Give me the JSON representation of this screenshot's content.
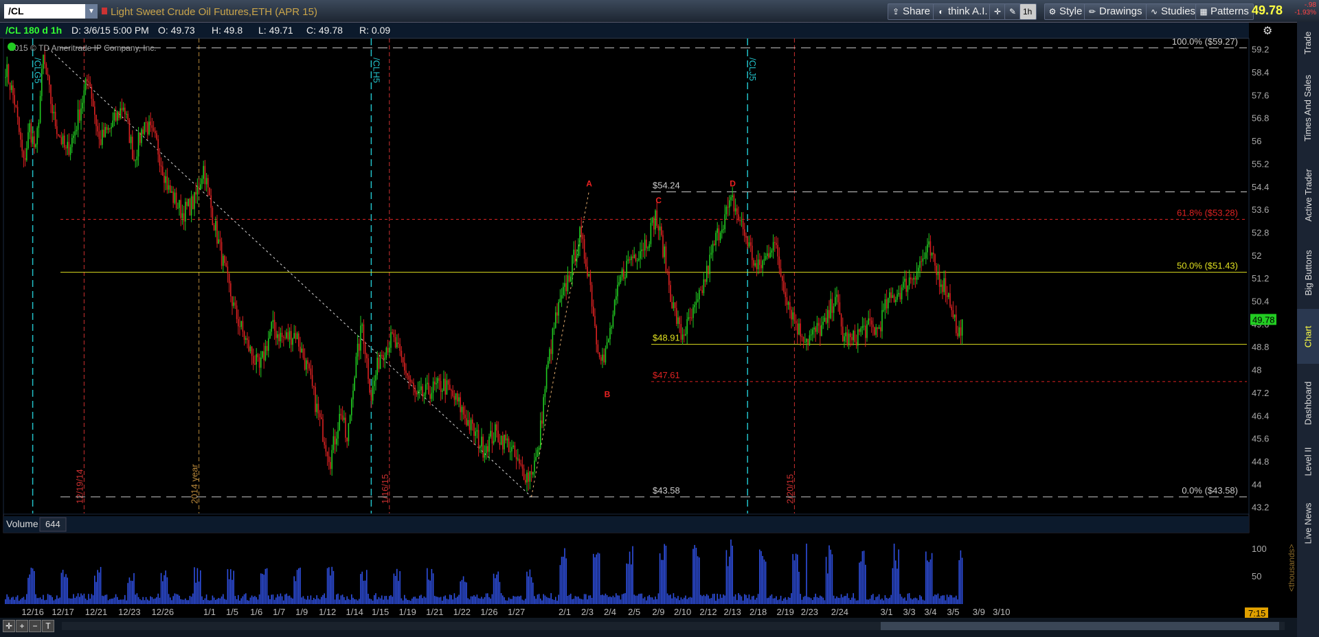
{
  "header": {
    "symbol": "/CL",
    "description": "Light Sweet Crude Oil Futures,ETH (APR 15)",
    "buttons": {
      "share": "Share",
      "think": "think A.I.",
      "interval": "1h",
      "style": "Style",
      "drawings": "Drawings",
      "studies": "Studies",
      "patterns": "Patterns"
    },
    "last_price": "49.78",
    "change": "-.98",
    "change_pct": "-1.93%"
  },
  "infobar": {
    "sym_interval": "/CL 180 d 1h",
    "date": "D: 3/6/15 5:00 PM",
    "open": "O: 49.73",
    "high": "H: 49.8",
    "low": "L: 49.71",
    "close": "C: 49.78",
    "range": "R: 0.09"
  },
  "copyright": "2015 © TD Ameritrade IP Company, Inc.",
  "side_tabs": [
    "Trade",
    "Times And Sales",
    "Active Trader",
    "Big Buttons",
    "Chart",
    "Dashboard",
    "Level II",
    "Live News"
  ],
  "colors": {
    "up": "#22cc22",
    "down": "#dd2222",
    "volume": "#2f4fe0",
    "fib": "#cccccc",
    "fib_mid": "#e0e020",
    "fib_618": "#dd2222",
    "expiry": "#22c0c8",
    "period": "#cc3030"
  },
  "volume_pane": {
    "label": "Volume",
    "value": "644",
    "unit": "<thousands>"
  },
  "timebar": {
    "expansion_label": "7:15"
  },
  "chart_data": [
    {
      "type": "candlestick",
      "name": "/CL price",
      "ylim": [
        43.0,
        59.6
      ],
      "yticks": [
        43.2,
        44,
        44.8,
        45.6,
        46.4,
        47.2,
        48,
        48.8,
        49.6,
        50.4,
        51.2,
        52,
        52.8,
        53.6,
        54.4,
        55.2,
        56,
        56.8,
        57.6,
        58.4,
        59.2
      ],
      "last_price_label": "49.78",
      "x_labels": [
        {
          "i": 18,
          "t": "12/16"
        },
        {
          "i": 38,
          "t": "12/17"
        },
        {
          "i": 60,
          "t": "12/21"
        },
        {
          "i": 82,
          "t": "12/23"
        },
        {
          "i": 104,
          "t": "12/26"
        },
        {
          "i": 135,
          "t": "1/1"
        },
        {
          "i": 150,
          "t": "1/5"
        },
        {
          "i": 166,
          "t": "1/6"
        },
        {
          "i": 181,
          "t": "1/7"
        },
        {
          "i": 196,
          "t": "1/9"
        },
        {
          "i": 213,
          "t": "1/12"
        },
        {
          "i": 231,
          "t": "1/14"
        },
        {
          "i": 248,
          "t": "1/15"
        },
        {
          "i": 266,
          "t": "1/19"
        },
        {
          "i": 284,
          "t": "1/21"
        },
        {
          "i": 302,
          "t": "1/22"
        },
        {
          "i": 320,
          "t": "1/26"
        },
        {
          "i": 338,
          "t": "1/27"
        },
        {
          "i": 370,
          "t": "2/1"
        },
        {
          "i": 385,
          "t": "2/3"
        },
        {
          "i": 400,
          "t": "2/4"
        },
        {
          "i": 416,
          "t": "2/5"
        },
        {
          "i": 432,
          "t": "2/9"
        },
        {
          "i": 448,
          "t": "2/10"
        },
        {
          "i": 465,
          "t": "2/12"
        },
        {
          "i": 481,
          "t": "2/13"
        },
        {
          "i": 498,
          "t": "2/18"
        },
        {
          "i": 516,
          "t": "2/19"
        },
        {
          "i": 532,
          "t": "2/23"
        },
        {
          "i": 552,
          "t": "2/24"
        },
        {
          "i": 583,
          "t": "3/1"
        },
        {
          "i": 598,
          "t": "3/3"
        },
        {
          "i": 612,
          "t": "3/4"
        },
        {
          "i": 627,
          "t": "3/5"
        },
        {
          "i": 644,
          "t": "3/9"
        },
        {
          "i": 659,
          "t": "3/10"
        }
      ],
      "anchors": [
        [
          0,
          58.6
        ],
        [
          6,
          57.4
        ],
        [
          12,
          55.2
        ],
        [
          16,
          56.5
        ],
        [
          20,
          55.6
        ],
        [
          25,
          58.9
        ],
        [
          32,
          56.8
        ],
        [
          40,
          55.6
        ],
        [
          45,
          56.2
        ],
        [
          55,
          58.3
        ],
        [
          62,
          56.0
        ],
        [
          70,
          56.5
        ],
        [
          78,
          57.3
        ],
        [
          85,
          55.4
        ],
        [
          92,
          56.7
        ],
        [
          100,
          55.9
        ],
        [
          108,
          54.3
        ],
        [
          117,
          53.5
        ],
        [
          125,
          53.9
        ],
        [
          131,
          55.1
        ],
        [
          137,
          53.4
        ],
        [
          145,
          51.5
        ],
        [
          152,
          50.0
        ],
        [
          160,
          48.9
        ],
        [
          168,
          48.0
        ],
        [
          176,
          49.5
        ],
        [
          184,
          49.1
        ],
        [
          192,
          49.3
        ],
        [
          200,
          48.0
        ],
        [
          208,
          46.2
        ],
        [
          215,
          44.9
        ],
        [
          222,
          46.6
        ],
        [
          226,
          45.4
        ],
        [
          230,
          47.6
        ],
        [
          236,
          49.6
        ],
        [
          242,
          47.1
        ],
        [
          248,
          48.6
        ],
        [
          256,
          49.1
        ],
        [
          264,
          48.1
        ],
        [
          272,
          47.0
        ],
        [
          281,
          47.3
        ],
        [
          290,
          47.5
        ],
        [
          300,
          46.8
        ],
        [
          308,
          46.0
        ],
        [
          316,
          45.3
        ],
        [
          324,
          45.8
        ],
        [
          333,
          45.4
        ],
        [
          340,
          44.6
        ],
        [
          346,
          44.3
        ],
        [
          352,
          45.0
        ],
        [
          358,
          47.9
        ],
        [
          364,
          49.8
        ],
        [
          370,
          50.8
        ],
        [
          376,
          51.9
        ],
        [
          380,
          52.7
        ],
        [
          386,
          51.4
        ],
        [
          391,
          49.1
        ],
        [
          396,
          48.3
        ],
        [
          401,
          49.6
        ],
        [
          407,
          51.2
        ],
        [
          413,
          51.9
        ],
        [
          419,
          52.2
        ],
        [
          425,
          52.6
        ],
        [
          430,
          53.4
        ],
        [
          435,
          52.3
        ],
        [
          441,
          50.4
        ],
        [
          447,
          49.2
        ],
        [
          452,
          49.6
        ],
        [
          458,
          50.3
        ],
        [
          464,
          51.4
        ],
        [
          470,
          52.6
        ],
        [
          476,
          53.4
        ],
        [
          481,
          53.9
        ],
        [
          486,
          53.2
        ],
        [
          491,
          52.5
        ],
        [
          497,
          51.5
        ],
        [
          503,
          51.9
        ],
        [
          508,
          52.6
        ],
        [
          513,
          51.4
        ],
        [
          519,
          50.2
        ],
        [
          525,
          49.4
        ],
        [
          531,
          49.1
        ],
        [
          537,
          49.4
        ],
        [
          543,
          49.6
        ],
        [
          549,
          50.7
        ],
        [
          554,
          49.2
        ],
        [
          560,
          49.0
        ],
        [
          566,
          49.4
        ],
        [
          572,
          49.5
        ],
        [
          577,
          49.4
        ],
        [
          583,
          50.3
        ],
        [
          588,
          50.6
        ],
        [
          594,
          50.9
        ],
        [
          600,
          51.3
        ],
        [
          606,
          51.8
        ],
        [
          611,
          52.2
        ],
        [
          616,
          51.4
        ],
        [
          622,
          50.9
        ],
        [
          627,
          50.1
        ],
        [
          630,
          49.1
        ],
        [
          633,
          49.78
        ]
      ],
      "fibonacci": {
        "levels": [
          {
            "label": "100.0%  ($59.27)",
            "value": 59.27
          },
          {
            "label": "61.8%  ($53.28)",
            "value": 53.28
          },
          {
            "label": "50.0%  ($51.43)",
            "value": 51.43
          },
          {
            "label": "0.0%  ($43.58)",
            "value": 43.58
          }
        ]
      },
      "horizontal_levels": [
        {
          "label": "$54.24",
          "value": 54.24
        },
        {
          "label": "$48.91",
          "value": 48.91
        },
        {
          "label": "$47.61",
          "value": 47.61
        },
        {
          "label": "$43.58",
          "value": 43.58
        }
      ],
      "pattern_points": [
        {
          "label": "A",
          "i": 386,
          "value": 54.24
        },
        {
          "label": "B",
          "i": 398,
          "value": 47.5
        },
        {
          "label": "C",
          "i": 432,
          "value": 53.65
        },
        {
          "label": "D",
          "i": 481,
          "value": 54.24
        }
      ],
      "expiry_markers": [
        {
          "i": 18,
          "label": "/CLG5"
        },
        {
          "i": 242,
          "label": "/CLH5"
        },
        {
          "i": 491,
          "label": "/CLJ5"
        }
      ],
      "period_markers": [
        {
          "i": 52,
          "label": "12/19/14"
        },
        {
          "i": 128,
          "label": "2014 year"
        },
        {
          "i": 254,
          "label": "1/16/15"
        },
        {
          "i": 522,
          "label": "2/20/15"
        }
      ],
      "trendline": {
        "start": {
          "i": 28,
          "value": 59.27
        },
        "end": {
          "i": 348,
          "value": 43.58
        }
      }
    },
    {
      "type": "bar",
      "name": "Volume",
      "ylim": [
        0,
        125
      ],
      "yticks": [
        50,
        100
      ],
      "unit": "<thousands>",
      "last_value": 644
    }
  ]
}
